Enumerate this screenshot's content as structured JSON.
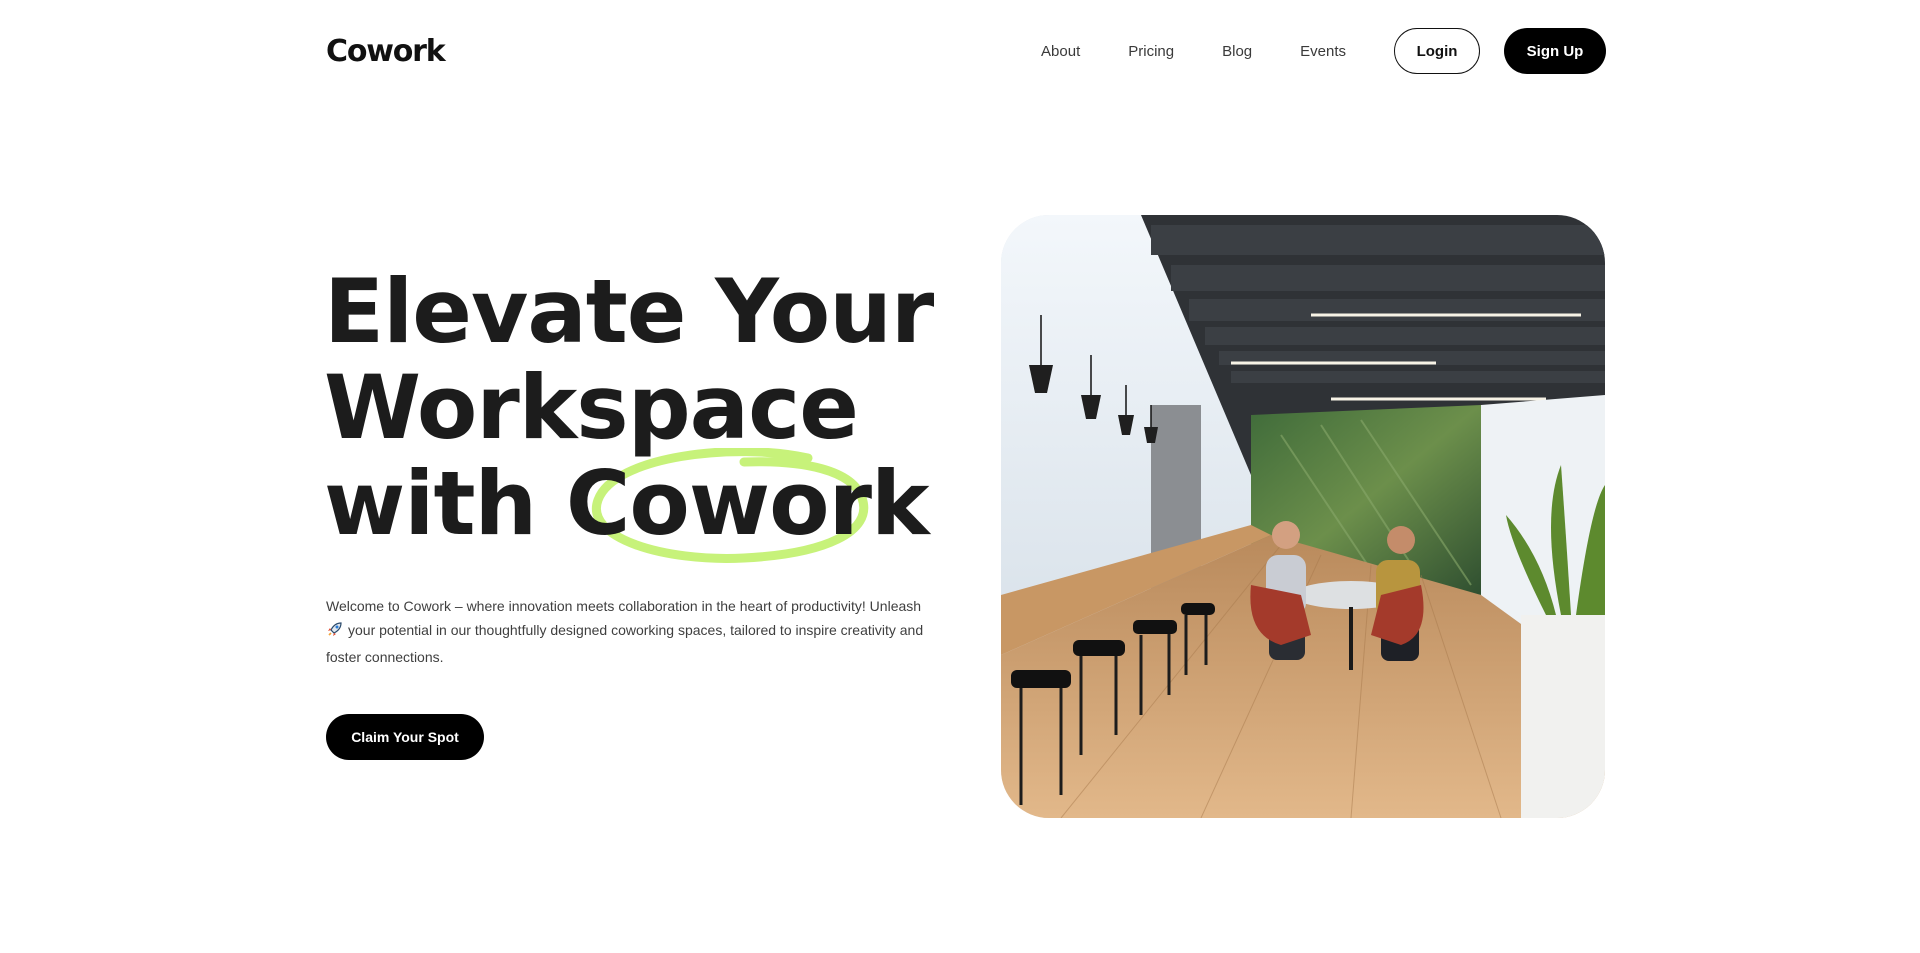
{
  "header": {
    "logo": "Cowork",
    "nav": [
      "About",
      "Pricing",
      "Blog",
      "Events"
    ],
    "login_label": "Login",
    "signup_label": "Sign Up"
  },
  "hero": {
    "title_line1": "Elevate Your",
    "title_line2": "Workspace",
    "title_line3_prefix": "with ",
    "title_line3_highlight": "Cowork",
    "description": "Welcome to Cowork – where innovation meets collaboration in the heart of productivity! Unleash",
    "description_cont": "your potential in our thoughtfully designed coworking spaces, tailored to inspire creativity and foster connections.",
    "cta_label": "Claim Your Spot",
    "highlight_color": "#c7f27a",
    "image_icon": "coworking-office-photo"
  }
}
